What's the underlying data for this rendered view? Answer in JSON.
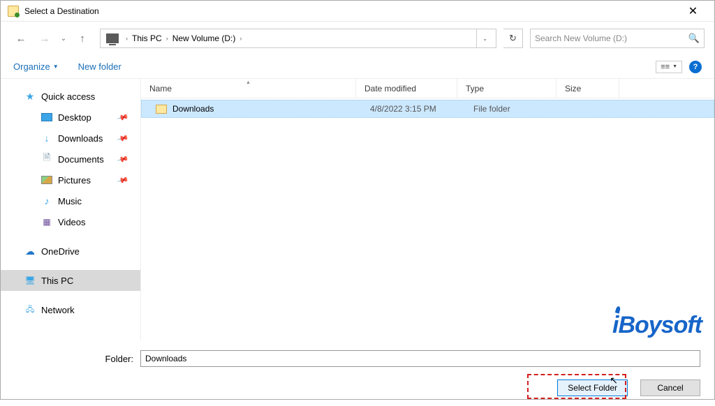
{
  "window": {
    "title": "Select a Destination"
  },
  "breadcrumb": {
    "root": "This PC",
    "folder": "New Volume (D:)"
  },
  "search": {
    "placeholder": "Search New Volume (D:)"
  },
  "toolbar": {
    "organize": "Organize",
    "newfolder": "New folder"
  },
  "sidebar": {
    "quickaccess": "Quick access",
    "items": [
      {
        "label": "Desktop",
        "pinned": true
      },
      {
        "label": "Downloads",
        "pinned": true
      },
      {
        "label": "Documents",
        "pinned": true
      },
      {
        "label": "Pictures",
        "pinned": true
      },
      {
        "label": "Music",
        "pinned": false
      },
      {
        "label": "Videos",
        "pinned": false
      }
    ],
    "onedrive": "OneDrive",
    "thispc": "This PC",
    "network": "Network"
  },
  "columns": {
    "name": "Name",
    "date": "Date modified",
    "type": "Type",
    "size": "Size"
  },
  "rows": [
    {
      "name": "Downloads",
      "date": "4/8/2022 3:15 PM",
      "type": "File folder"
    }
  ],
  "folderfield": {
    "label": "Folder:",
    "value": "Downloads"
  },
  "buttons": {
    "select": "Select Folder",
    "cancel": "Cancel"
  },
  "watermark": "iBoysoft"
}
